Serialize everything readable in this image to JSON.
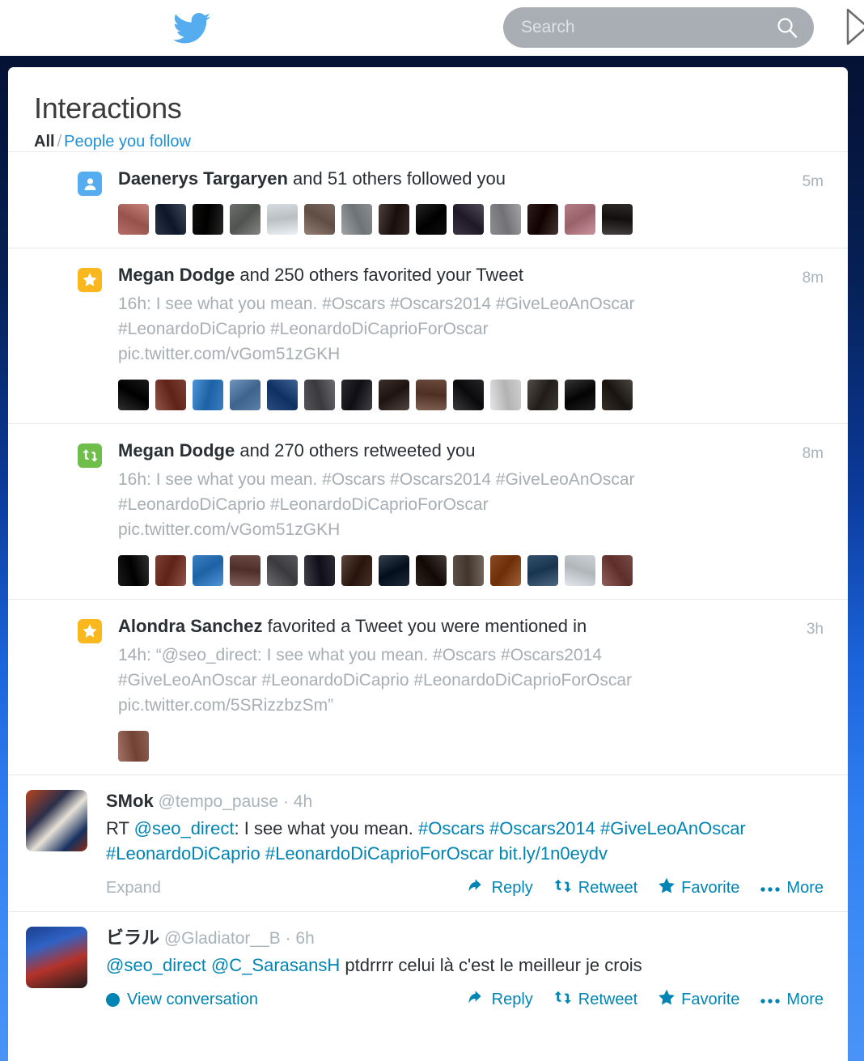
{
  "topbar": {
    "logo_icon": "twitter-bird-icon",
    "search": {
      "placeholder": "Search",
      "value": "",
      "icon": "search-icon"
    },
    "nav_icon": "next-arrow-icon"
  },
  "page": {
    "title": "Interactions",
    "filters": {
      "all": "All",
      "separator": "/",
      "people_you_follow": "People you follow"
    }
  },
  "colors": {
    "twitter_blue": "#55acee",
    "link_blue": "#0084b4",
    "favorite_orange": "#fab81e",
    "retweet_green": "#6fbe4c",
    "muted_gray": "#a9b3ba"
  },
  "interactions": [
    {
      "type": "follow",
      "icon": "person-icon",
      "actor": "Daenerys Targaryen",
      "rest": " and 51 others followed you",
      "detail_lines": [],
      "time": "5m",
      "avatar_count": 14,
      "avatars": [
        "#b36f67",
        "#2a3346",
        "#10100f",
        "#6d6f6c",
        "#d6dbe0",
        "#7c6a60",
        "#8b8f91",
        "#352a27",
        "#0e0e0e",
        "#3b3543",
        "#8e8d92",
        "#2d1e1c",
        "#b57d86",
        "#2e2b2a"
      ]
    },
    {
      "type": "favorite",
      "icon": "star-icon",
      "actor": "Megan Dodge",
      "rest": " and 250 others favorited your Tweet",
      "detail_lines": [
        "16h: I see what you mean. #Oscars #Oscars2014 #GiveLeoAnOscar",
        "#LeonardoDiCaprio #LeonardoDiCaprioForOscar",
        "pic.twitter.com/vGom51zGKH"
      ],
      "time": "8m",
      "avatar_count": 14,
      "avatars": [
        "#1a1a1c",
        "#7b3f34",
        "#3a7ec2",
        "#5a7fa8",
        "#2b4c7e",
        "#56565a",
        "#2b2b2f",
        "#3b2f2c",
        "#6b4b3e",
        "#262628",
        "#cfcfcf",
        "#3d3833",
        "#201f1f",
        "#35302c"
      ]
    },
    {
      "type": "retweet",
      "icon": "retweet-icon",
      "actor": "Megan Dodge",
      "rest": " and 270 others retweeted you",
      "detail_lines": [
        "16h: I see what you mean. #Oscars #Oscars2014 #GiveLeoAnOscar",
        "#LeonardoDiCaprio #LeonardoDiCaprioForOscar",
        "pic.twitter.com/vGom51zGKH"
      ],
      "time": "8m",
      "avatar_count": 14,
      "avatars": [
        "#1a1a1c",
        "#7b3f34",
        "#3a7ec2",
        "#6b4a45",
        "#57565a",
        "#2c2a33",
        "#453028",
        "#1f2a38",
        "#2f2520",
        "#5e5147",
        "#8a4a23",
        "#34506b",
        "#cdd2d6",
        "#7a4a46"
      ]
    },
    {
      "type": "favorite",
      "icon": "star-icon",
      "actor": "Alondra Sanchez",
      "rest": " favorited a Tweet you were mentioned in",
      "detail_lines": [
        "14h: “@seo_direct: I see what you mean. #Oscars #Oscars2014",
        "#GiveLeoAnOscar #LeonardoDiCaprio #LeonardoDiCaprioForOscar",
        "pic.twitter.com/5SRizzbzSm”"
      ],
      "time": "3h",
      "avatar_count": 1,
      "avatars": [
        "#8e5f51"
      ]
    }
  ],
  "tweets": [
    {
      "avatar": "smok-avatar",
      "name": "SMok",
      "handle": "@tempo_pause",
      "dot": "·",
      "time": "4h",
      "segments": [
        {
          "text": "RT ",
          "link": false
        },
        {
          "text": "@seo_direct",
          "link": true
        },
        {
          "text": ": I see what you mean. ",
          "link": false
        },
        {
          "text": "#Oscars",
          "link": true
        },
        {
          "text": " ",
          "link": false
        },
        {
          "text": "#Oscars2014",
          "link": true
        },
        {
          "text": " ",
          "link": false
        },
        {
          "text": "#GiveLeoAnOscar",
          "link": true
        },
        {
          "text": " ",
          "link": false
        },
        {
          "text": "#LeonardoDiCaprio",
          "link": true
        },
        {
          "text": " ",
          "link": false
        },
        {
          "text": "#LeonardoDiCaprioForOscar",
          "link": true
        },
        {
          "text": " ",
          "link": false
        },
        {
          "text": "bit.ly/1n0eydv",
          "link": true
        }
      ],
      "footer_label": "Expand",
      "footer_type": "expand",
      "actions": [
        {
          "label": "Reply",
          "icon": "reply-arrow-icon"
        },
        {
          "label": "Retweet",
          "icon": "retweet-icon"
        },
        {
          "label": "Favorite",
          "icon": "star-icon"
        },
        {
          "label": "More",
          "icon": "more-dots-icon"
        }
      ]
    },
    {
      "avatar": "gladiator-avatar",
      "name": "ビラル",
      "handle": "@Gladiator__B",
      "dot": "·",
      "time": "6h",
      "segments": [
        {
          "text": "@seo_direct",
          "link": true
        },
        {
          "text": " ",
          "link": false
        },
        {
          "text": "@C_SarasansH",
          "link": true
        },
        {
          "text": " ptdrrrr celui là c'est le meilleur je crois",
          "link": false
        }
      ],
      "footer_label": "View conversation",
      "footer_type": "conversation",
      "actions": [
        {
          "label": "Reply",
          "icon": "reply-arrow-icon"
        },
        {
          "label": "Retweet",
          "icon": "retweet-icon"
        },
        {
          "label": "Favorite",
          "icon": "star-icon"
        },
        {
          "label": "More",
          "icon": "more-dots-icon"
        }
      ]
    }
  ]
}
